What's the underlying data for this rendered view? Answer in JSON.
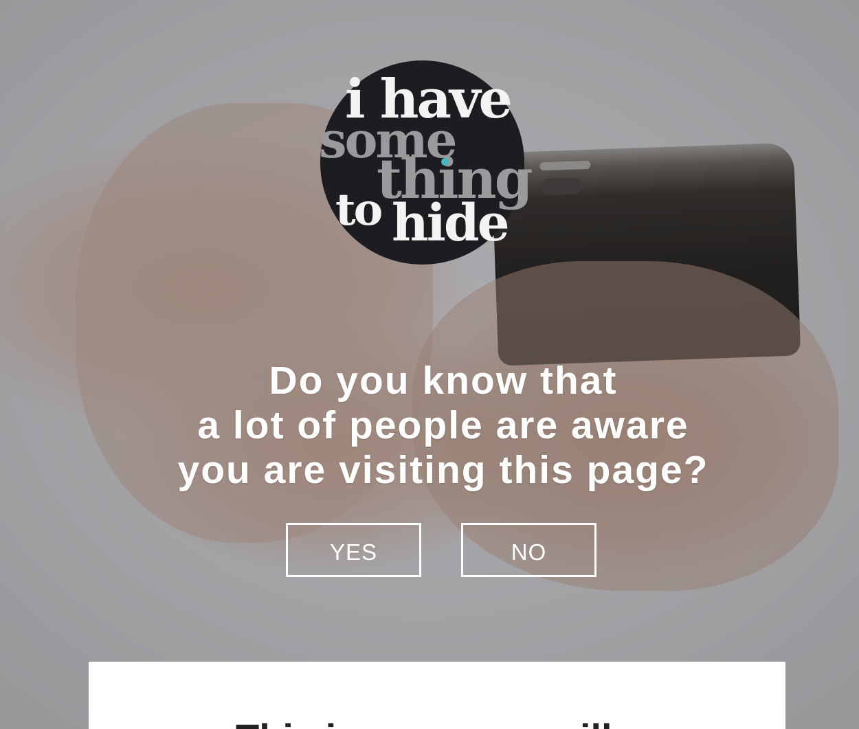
{
  "logo": {
    "line1": "i have",
    "line2": "some",
    "line3": "thing",
    "line4a": "to",
    "line4b": "hide"
  },
  "headline": {
    "line1": "Do you know that",
    "line2": "a lot of people are aware",
    "line3": "you are visiting this page?"
  },
  "buttons": {
    "yes": "YES",
    "no": "NO"
  },
  "card": {
    "text": "This is your own will"
  },
  "colors": {
    "logo_background": "#1d1c20",
    "logo_accent_dot": "#49b6c0",
    "logo_grey_text": "#9a9a9d",
    "button_border": "#ffffff"
  }
}
